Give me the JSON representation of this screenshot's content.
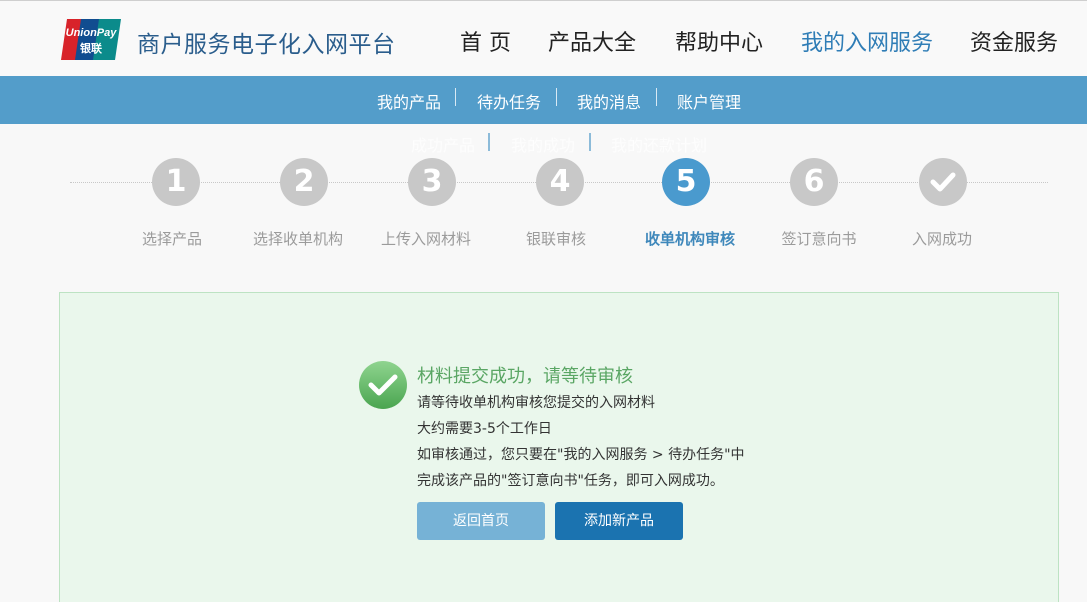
{
  "header": {
    "logo_text_1": "UnionPay",
    "logo_text_2": "银联",
    "site_title": "商户服务电子化入网平台",
    "nav": [
      {
        "label": "首 页",
        "active": false
      },
      {
        "label": "产品大全",
        "active": false
      },
      {
        "label": "帮助中心",
        "active": false
      },
      {
        "label": "我的入网服务",
        "active": true
      },
      {
        "label": "资金服务",
        "active": false
      }
    ]
  },
  "subnav": {
    "items": [
      {
        "label": "我的产品"
      },
      {
        "label": "待办任务"
      },
      {
        "label": "我的消息"
      },
      {
        "label": "账户管理"
      }
    ]
  },
  "ghost_nav": {
    "items": [
      {
        "label": "成功产品"
      },
      {
        "label": "我的成功"
      },
      {
        "label": "我的还款计划"
      }
    ]
  },
  "steps": [
    {
      "number": "1",
      "label": "选择产品",
      "current": false
    },
    {
      "number": "2",
      "label": "选择收单机构",
      "current": false
    },
    {
      "number": "3",
      "label": "上传入网材料",
      "current": false
    },
    {
      "number": "4",
      "label": "银联审核",
      "current": false
    },
    {
      "number": "5",
      "label": "收单机构审核",
      "current": true
    },
    {
      "number": "6",
      "label": "签订意向书",
      "current": false
    },
    {
      "number": "✔",
      "label": "入网成功",
      "current": false
    }
  ],
  "result": {
    "title": "材料提交成功，请等待审核",
    "lines": [
      "请等待收单机构审核您提交的入网材料",
      "大约需要3-5个工作日",
      "如审核通过，您只要在\"我的入网服务 > 待办任务\"中",
      "完成该产品的\"签订意向书\"任务，即可入网成功。"
    ],
    "back_button": "返回首页",
    "add_button": "添加新产品"
  },
  "colors": {
    "accent": "#539dca",
    "active_nav": "#2f7db6",
    "success": "#5aa664",
    "step_current": "#4a9ace",
    "step_inactive": "#c8c8c8"
  }
}
